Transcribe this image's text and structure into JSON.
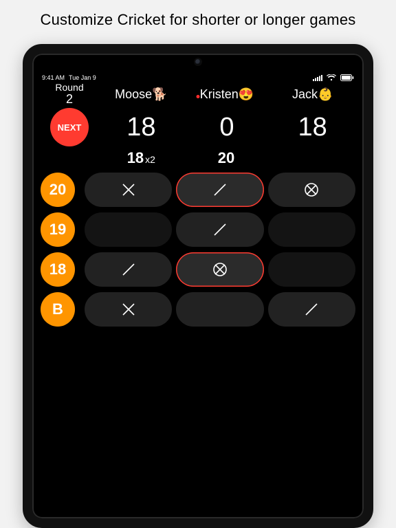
{
  "caption": "Customize Cricket for shorter or longer games",
  "status": {
    "time": "9:41 AM",
    "date": "Tue Jan 9"
  },
  "round": {
    "label": "Round",
    "number": "2"
  },
  "next_label": "NEXT",
  "players": [
    {
      "name": "Moose🐕",
      "score": "18",
      "last_hit": "18",
      "last_mult": "x2"
    },
    {
      "name": "Kristen😍",
      "score": "0",
      "last_hit": "20",
      "last_mult": ""
    },
    {
      "name": "Jack👶",
      "score": "18",
      "last_hit": "",
      "last_mult": ""
    }
  ],
  "targets": [
    "20",
    "19",
    "18",
    "B"
  ],
  "cells": [
    [
      {
        "mark": "x",
        "active": true,
        "highlight": false
      },
      {
        "mark": "slash",
        "active": true,
        "highlight": true
      },
      {
        "mark": "closed",
        "active": true,
        "highlight": false
      }
    ],
    [
      {
        "mark": "",
        "active": false,
        "highlight": false
      },
      {
        "mark": "slash",
        "active": true,
        "highlight": false
      },
      {
        "mark": "",
        "active": false,
        "highlight": false
      }
    ],
    [
      {
        "mark": "slash",
        "active": true,
        "highlight": false
      },
      {
        "mark": "closed",
        "active": true,
        "highlight": true
      },
      {
        "mark": "",
        "active": false,
        "highlight": false
      }
    ],
    [
      {
        "mark": "x",
        "active": true,
        "highlight": false
      },
      {
        "mark": "",
        "active": true,
        "highlight": false
      },
      {
        "mark": "slash",
        "active": true,
        "highlight": false
      }
    ]
  ],
  "colors": {
    "accent_orange": "#ff9500",
    "accent_red": "#ff3b30"
  }
}
